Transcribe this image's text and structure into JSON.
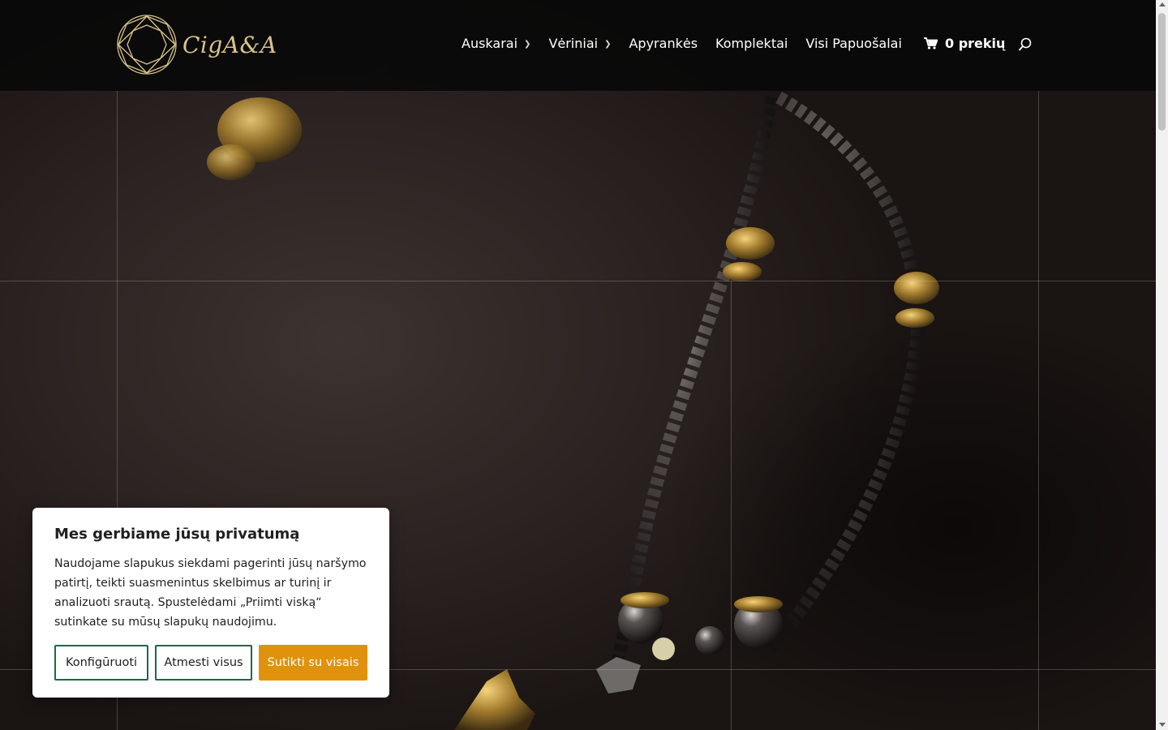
{
  "brand": {
    "name": "CigA&A"
  },
  "nav": {
    "items": [
      {
        "label": "Auskarai",
        "dropdown": true
      },
      {
        "label": "Vėriniai",
        "dropdown": true
      },
      {
        "label": "Apyrankės",
        "dropdown": false
      },
      {
        "label": "Komplektai",
        "dropdown": false
      },
      {
        "label": "Visi Papuošalai",
        "dropdown": false
      }
    ],
    "cart_label": "0 prekių",
    "search_icon": "search-icon",
    "cart_icon": "shopping-cart-icon"
  },
  "cookie": {
    "title": "Mes gerbiame jūsų privatumą",
    "text": "Naudojame slapukus siekdami pagerinti jūsų naršymo patirtį, teikti suasmenintus skelbimus ar turinį ir analizuoti srautą. Spustelėdami „Priimti viską“ sutinkate su mūsų slapukų naudojimu.",
    "configure_label": "Konfigūruoti",
    "reject_label": "Atmesti visus",
    "accept_label": "Sutikti su visais"
  },
  "colors": {
    "accent": "#e0920c",
    "button_border": "#1a6b45",
    "logo_gold": "#d9c38a",
    "header_bg": "#080808"
  }
}
